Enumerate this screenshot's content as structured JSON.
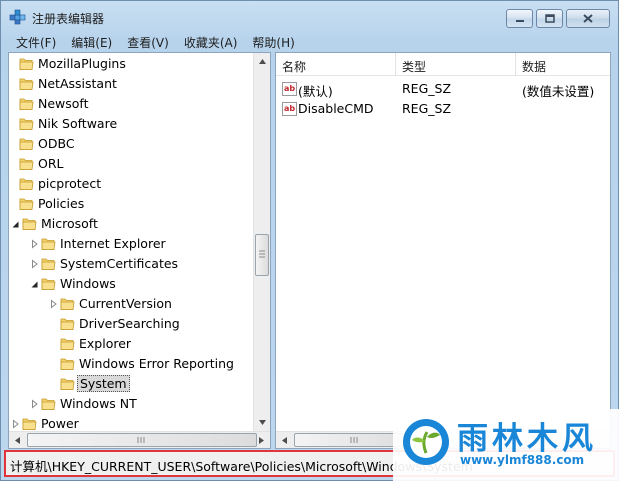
{
  "window": {
    "title": "注册表编辑器",
    "controls": {
      "minimize": "minimize",
      "maximize": "maximize",
      "close": "close"
    }
  },
  "menu": [
    "文件(F)",
    "编辑(E)",
    "查看(V)",
    "收藏夹(A)",
    "帮助(H)"
  ],
  "tree": {
    "items": [
      {
        "label": "MozillaPlugins",
        "depth": 0,
        "expander": "none",
        "selected": false
      },
      {
        "label": "NetAssistant",
        "depth": 0,
        "expander": "none",
        "selected": false
      },
      {
        "label": "Newsoft",
        "depth": 0,
        "expander": "none",
        "selected": false
      },
      {
        "label": "Nik Software",
        "depth": 0,
        "expander": "none",
        "selected": false
      },
      {
        "label": "ODBC",
        "depth": 0,
        "expander": "none",
        "selected": false
      },
      {
        "label": "ORL",
        "depth": 0,
        "expander": "none",
        "selected": false
      },
      {
        "label": "picprotect",
        "depth": 0,
        "expander": "none",
        "selected": false
      },
      {
        "label": "Policies",
        "depth": 0,
        "expander": "none",
        "selected": false
      },
      {
        "label": "Microsoft",
        "depth": 1,
        "expander": "expanded",
        "selected": false
      },
      {
        "label": "Internet Explorer",
        "depth": 2,
        "expander": "collapsed",
        "selected": false
      },
      {
        "label": "SystemCertificates",
        "depth": 2,
        "expander": "collapsed",
        "selected": false
      },
      {
        "label": "Windows",
        "depth": 2,
        "expander": "expanded",
        "selected": false
      },
      {
        "label": "CurrentVersion",
        "depth": 3,
        "expander": "collapsed",
        "selected": false
      },
      {
        "label": "DriverSearching",
        "depth": 3,
        "expander": "none",
        "selected": false
      },
      {
        "label": "Explorer",
        "depth": 3,
        "expander": "none",
        "selected": false
      },
      {
        "label": "Windows Error Reporting",
        "depth": 3,
        "expander": "none",
        "selected": false
      },
      {
        "label": "System",
        "depth": 3,
        "expander": "none",
        "selected": true
      },
      {
        "label": "Windows NT",
        "depth": 2,
        "expander": "collapsed",
        "selected": false
      },
      {
        "label": "Power",
        "depth": 1,
        "expander": "collapsed",
        "selected": false
      }
    ]
  },
  "list": {
    "columns": [
      "名称",
      "类型",
      "数据"
    ],
    "rows": [
      {
        "icon": "string-value-icon",
        "name": "(默认)",
        "type": "REG_SZ",
        "data": "(数值未设置)"
      },
      {
        "icon": "string-value-icon",
        "name": "DisableCMD",
        "type": "REG_SZ",
        "data": ""
      }
    ]
  },
  "status": {
    "path": "计算机\\HKEY_CURRENT_USER\\Software\\Policies\\Microsoft\\Windows\\System"
  },
  "watermark": {
    "brand": "雨林木风",
    "url": "www.ylmf888.com"
  },
  "colors": {
    "status_border": "#e0353b",
    "watermark_blue": "#1a86d8",
    "folder_yellow": "#f3d26b"
  }
}
